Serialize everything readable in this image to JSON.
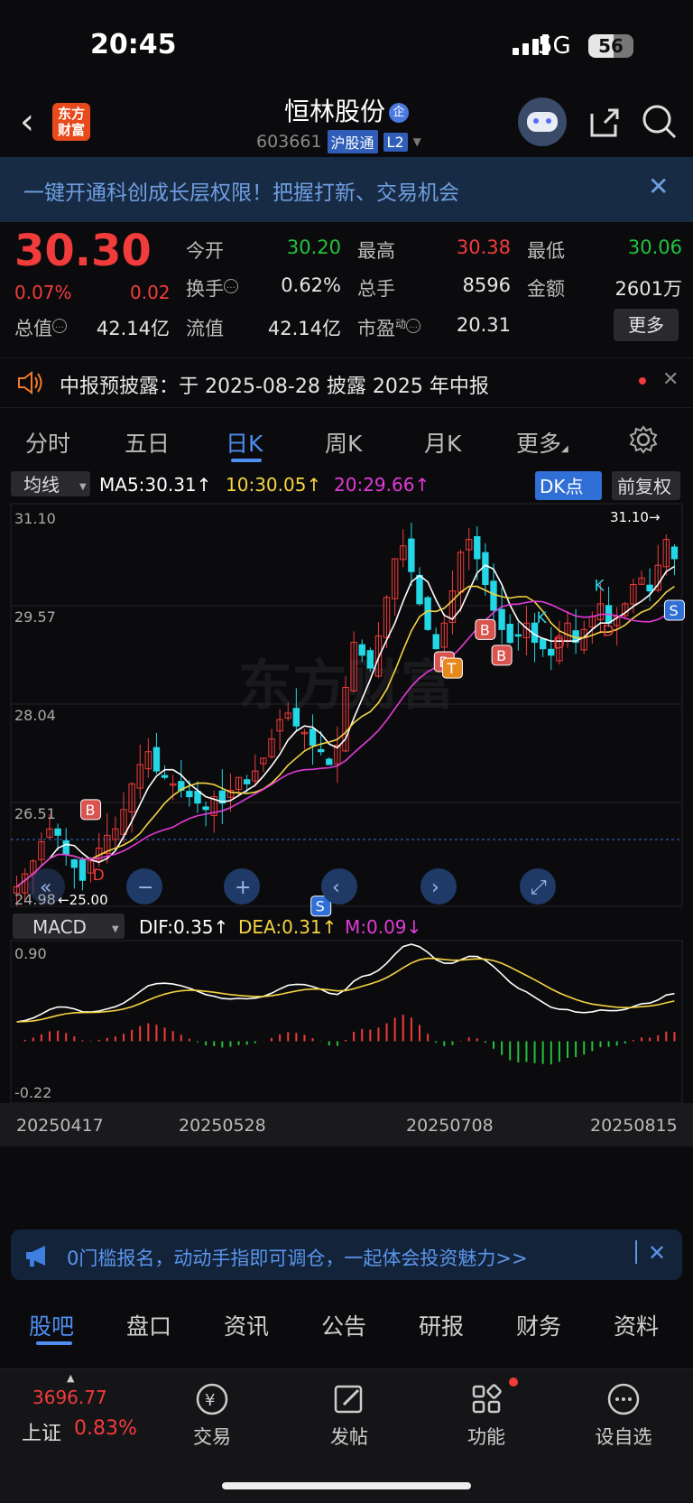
{
  "status_bar": {
    "time": "20:45",
    "network": "5G",
    "battery": "56",
    "battery_level": 0.56
  },
  "header": {
    "logo_text": "东方财富",
    "stock_name": "恒林股份",
    "ent_badge": "企",
    "stock_code": "603661",
    "tag_connect": "沪股通",
    "tag_level": "L2"
  },
  "banner": {
    "text": "一键开通科创成长层权限！把握打新、交易机会",
    "close": "✕"
  },
  "quote": {
    "price": "30.30",
    "pct": "0.07%",
    "change": "0.02",
    "open_label": "今开",
    "open": "30.20",
    "high_label": "最高",
    "high": "30.38",
    "low_label": "最低",
    "low": "30.06",
    "turnover_label": "换手",
    "turnover": "0.62%",
    "volume_label": "总手",
    "volume": "8596",
    "amount_label": "金额",
    "amount": "2601万",
    "mktcap_label": "总值",
    "mktcap": "42.14亿",
    "float_label": "流值",
    "float_cap": "42.14亿",
    "pe_label": "市盈",
    "pe_sup": "动",
    "pe": "20.31",
    "more": "更多"
  },
  "notice": {
    "text": "中报预披露：于 2025-08-28 披露 2025 年中报",
    "close": "✕"
  },
  "kline_tabs": [
    "分时",
    "五日",
    "日K",
    "周K",
    "月K",
    "更多"
  ],
  "active_tab": "日K",
  "ma_bar": {
    "selector": "均线",
    "ma5": "MA5:30.31↑",
    "ma10": "10:30.05↑",
    "ma20": "20:29.66↑",
    "dk": "DK点",
    "adjust": "前复权"
  },
  "chart_data": [
    {
      "type": "candlestick",
      "y_ticks": [
        "31.10",
        "29.57",
        "28.04",
        "26.51",
        "24.98"
      ],
      "ylim": [
        24.98,
        31.1
      ],
      "max_marker": "31.10→",
      "min_marker": "←25.00",
      "watermark": "东方财富",
      "signals": [
        {
          "label": "B",
          "x_index": 9,
          "price": 26.4
        },
        {
          "label": "B",
          "x_index": 57,
          "price": 29.2
        },
        {
          "label": "B",
          "x_index": 59,
          "price": 28.8
        },
        {
          "label": "B",
          "x_index": 52,
          "price": 28.7
        },
        {
          "label": "T",
          "x_index": 53,
          "price": 28.6
        },
        {
          "label": "S",
          "x_index": 80,
          "price": 29.5
        },
        {
          "label": "D",
          "x_index": 10,
          "price": 25.3
        },
        {
          "label": "D",
          "x_index": 66,
          "price": 28.9
        },
        {
          "label": "D",
          "x_index": 72,
          "price": 29.1
        },
        {
          "label": "K",
          "x_index": 64,
          "price": 29.3
        },
        {
          "label": "K",
          "x_index": 71,
          "price": 29.8
        },
        {
          "label": "S",
          "x_index": 37,
          "price": 24.9
        }
      ],
      "closes": [
        25.2,
        25.4,
        25.6,
        25.9,
        26.1,
        26.0,
        25.7,
        25.5,
        25.3,
        25.6,
        25.8,
        26.0,
        26.1,
        26.4,
        26.8,
        27.1,
        27.3,
        27.0,
        26.9,
        26.8,
        26.7,
        26.6,
        26.5,
        26.4,
        26.6,
        26.5,
        26.7,
        26.9,
        26.8,
        27.0,
        27.2,
        27.5,
        27.8,
        27.9,
        27.7,
        27.6,
        27.4,
        27.3,
        27.1,
        27.4,
        28.3,
        29.0,
        28.8,
        28.6,
        29.1,
        29.7,
        30.3,
        30.5,
        30.1,
        29.6,
        29.2,
        28.9,
        29.3,
        29.8,
        30.4,
        30.6,
        30.3,
        29.9,
        29.5,
        29.2,
        29.0,
        29.1,
        29.3,
        29.0,
        28.9,
        28.8,
        29.1,
        29.3,
        29.0,
        29.2,
        29.4,
        29.6,
        29.3,
        29.4,
        29.6,
        29.9,
        30.0,
        29.8,
        30.2,
        30.6,
        30.3
      ]
    },
    {
      "type": "bar",
      "indicator": "MACD",
      "dif": "DIF:0.35↑",
      "dea": "DEA:0.31↑",
      "m": "M:0.09↓",
      "y_ticks": [
        "0.90",
        "-0.22"
      ],
      "ylim": [
        -0.22,
        0.9
      ],
      "x_ticks": [
        "20250417",
        "20250528",
        "20250708",
        "20250815"
      ]
    }
  ],
  "chart_controls": [
    "«",
    "−",
    "+",
    "‹",
    "›",
    "⤢"
  ],
  "ad": {
    "text": "0门槛报名，动动手指即可调仓，一起体会投资魅力>>",
    "close": "✕"
  },
  "bottom_tabs": [
    "股吧",
    "盘口",
    "资讯",
    "公告",
    "研报",
    "财务",
    "资料"
  ],
  "nav": {
    "index_value": "3696.77",
    "index_name": "上证",
    "index_pct": "0.83%",
    "items": [
      "交易",
      "发帖",
      "功能",
      "设自选"
    ]
  }
}
